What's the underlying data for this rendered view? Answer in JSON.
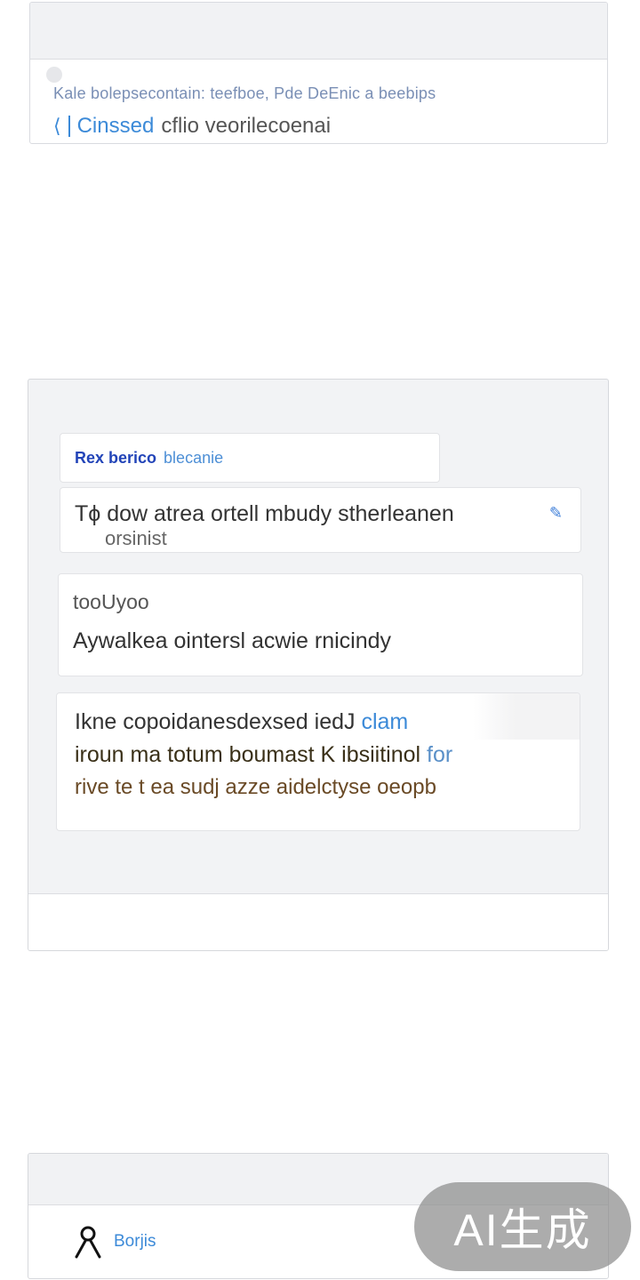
{
  "top_card": {
    "line1": "Kale bolepsecontain: teefboe, Pde DeEnic a beebips",
    "line2_prefix": "Cinssed",
    "line2_rest": "cflio veorilecoenai"
  },
  "chat": {
    "bubble1": {
      "strong": "Rex berico",
      "soft": "blecanie"
    },
    "bubble2": {
      "main": "Tϕ dow atrea ortell mbudy stherleanen",
      "sub": "orsinist"
    },
    "bubble3": {
      "small": "tooUyoo",
      "big": "Aywalkea ointersl acwie rnicindy"
    },
    "bubble4": {
      "t1_main": "Ikne copoidanesdexsed iedJ",
      "t1_hl": "clam",
      "t2_main": "iroun ma totum boumast K ibsiitinol",
      "t2_hl": "for",
      "t3": "rive te t ea sudj azze aidelctyse oeopb"
    }
  },
  "bottom_card": {
    "label": "Borjis"
  },
  "badge": {
    "text": "AI生成"
  },
  "colors": {
    "accent": "#3c8ad8",
    "panel_bg": "#f2f3f5",
    "header_bg": "#f1f2f4"
  }
}
